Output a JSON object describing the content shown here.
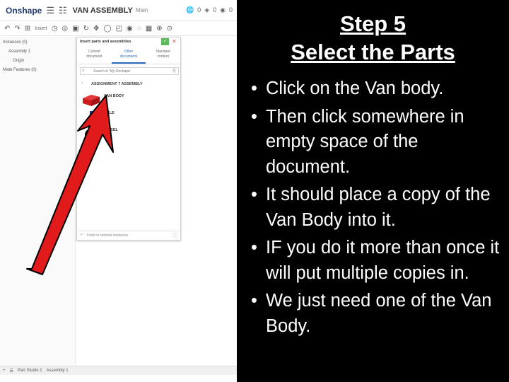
{
  "app": {
    "logo": "Onshape",
    "document_title": "VAN ASSEMBLY",
    "branch": "Main",
    "counts": [
      "0",
      "0",
      "0"
    ],
    "insert_label": "Insert"
  },
  "left_panel": {
    "instances_header": "Instances (0)",
    "assembly": "Assembly 1",
    "origin": "Origin",
    "mate_features": "Mate Features (0)"
  },
  "insert_dialog": {
    "title": "Insert parts and assemblies",
    "tabs": [
      {
        "line1": "Current",
        "line2": "document",
        "active": false
      },
      {
        "line1": "Other",
        "line2": "documents",
        "active": true
      },
      {
        "line1": "Standard",
        "line2": "content",
        "active": false
      }
    ],
    "search_placeholder": "Search in 'My Onshape'",
    "breadcrumb": "ASSIGNMENT 7 ASSEMBLY",
    "parts": [
      {
        "name": "VAN BODY",
        "color": "#cc1b1b"
      },
      {
        "name": "AXLE",
        "color": "#1e3aa8"
      },
      {
        "name": "WHEEL",
        "color": "#111111"
      }
    ],
    "footer_hint": "Undo to remove instances"
  },
  "bottom_tabs": {
    "part_studio": "Part Studio 1",
    "assembly": "Assembly 1"
  },
  "slide": {
    "title_line1": "Step 5",
    "title_line2": "Select the Parts",
    "bullets": [
      "Click on the Van body.",
      "Then click somewhere in empty space of the document.",
      "It should place a copy of the Van Body into it.",
      "IF you do it more than once it will put multiple copies in.",
      "We just need one of the Van Body."
    ]
  },
  "colors": {
    "background": "#000000",
    "text": "#ffffff",
    "arrow": "#e11b1b",
    "accent": "#2a6ebb"
  }
}
